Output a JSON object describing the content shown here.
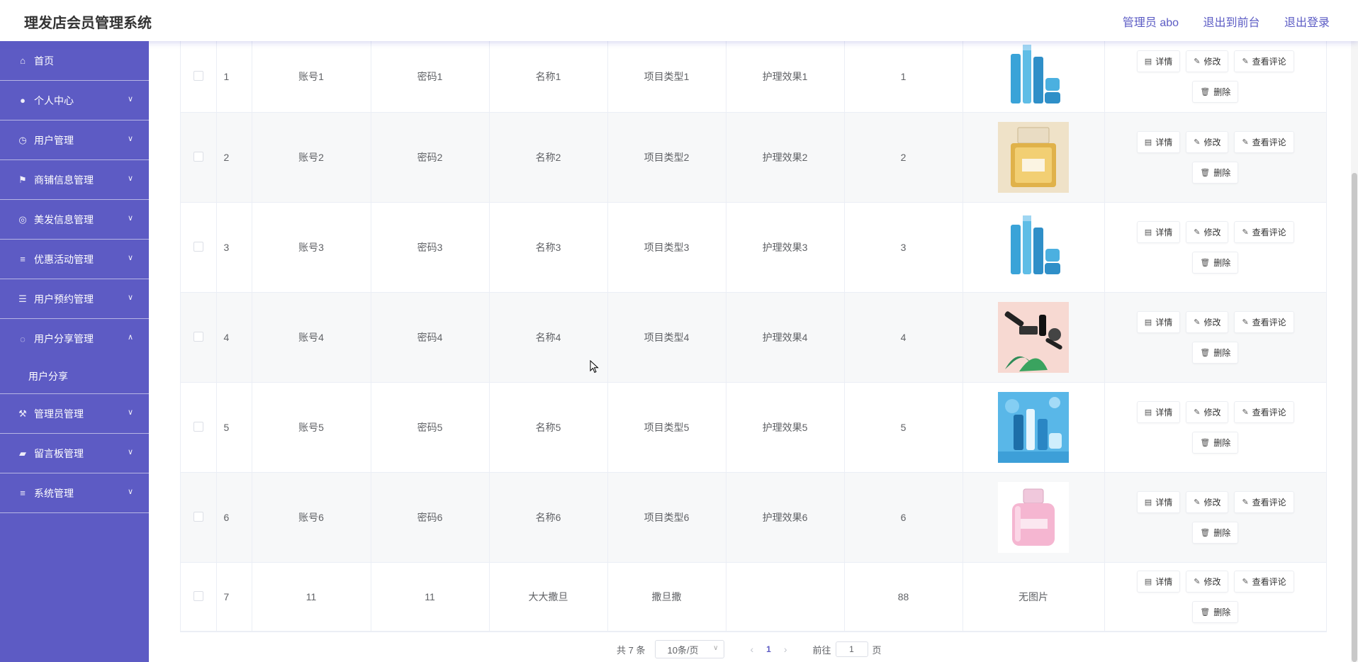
{
  "header": {
    "title": "理发店会员管理系统",
    "admin_label": "管理员 abo",
    "to_front": "退出到前台",
    "logout": "退出登录"
  },
  "sidebar": {
    "items": [
      {
        "label": "首页",
        "icon": "home-icon",
        "chevron": false
      },
      {
        "label": "个人中心",
        "icon": "user-icon",
        "chevron": true
      },
      {
        "label": "用户管理",
        "icon": "clock-icon",
        "chevron": true
      },
      {
        "label": "商铺信息管理",
        "icon": "flag-icon",
        "chevron": true
      },
      {
        "label": "美发信息管理",
        "icon": "compass-icon",
        "chevron": true
      },
      {
        "label": "优惠活动管理",
        "icon": "list-icon",
        "chevron": true
      },
      {
        "label": "用户预约管理",
        "icon": "sliders-icon",
        "chevron": true
      },
      {
        "label": "用户分享管理",
        "icon": "target-icon",
        "chevron": true,
        "expanded": true,
        "sub": "用户分享"
      },
      {
        "label": "管理员管理",
        "icon": "tools-icon",
        "chevron": true
      },
      {
        "label": "留言板管理",
        "icon": "ticket-icon",
        "chevron": true
      },
      {
        "label": "系统管理",
        "icon": "menu-icon",
        "chevron": true
      }
    ]
  },
  "table": {
    "rows": [
      {
        "no": "1",
        "account": "账号1",
        "password": "密码1",
        "name": "名称1",
        "type": "项目类型1",
        "effect": "护理效果1",
        "count": "1",
        "image": "skincare-blue"
      },
      {
        "no": "2",
        "account": "账号2",
        "password": "密码2",
        "name": "名称2",
        "type": "项目类型2",
        "effect": "护理效果2",
        "count": "2",
        "image": "perfume-gold"
      },
      {
        "no": "3",
        "account": "账号3",
        "password": "密码3",
        "name": "名称3",
        "type": "项目类型3",
        "effect": "护理效果3",
        "count": "3",
        "image": "skincare-blue"
      },
      {
        "no": "4",
        "account": "账号4",
        "password": "密码4",
        "name": "名称4",
        "type": "项目类型4",
        "effect": "护理效果4",
        "count": "4",
        "image": "makeup-pink"
      },
      {
        "no": "5",
        "account": "账号5",
        "password": "密码5",
        "name": "名称5",
        "type": "项目类型5",
        "effect": "护理效果5",
        "count": "5",
        "image": "skincare-splash"
      },
      {
        "no": "6",
        "account": "账号6",
        "password": "密码6",
        "name": "名称6",
        "type": "项目类型6",
        "effect": "护理效果6",
        "count": "6",
        "image": "perfume-pink"
      },
      {
        "no": "7",
        "account": "11",
        "password": "11",
        "name": "大大撒旦",
        "type": "撒旦撒",
        "effect": "",
        "count": "88",
        "image": "none",
        "no_image_text": "无图片"
      }
    ],
    "buttons": {
      "detail": "详情",
      "edit": "修改",
      "comments": "查看评论",
      "delete": "删除"
    }
  },
  "pagination": {
    "total": "共 7 条",
    "page_size": "10条/页",
    "current": "1",
    "goto_prefix": "前往",
    "goto_value": "1",
    "goto_suffix": "页"
  },
  "colors": {
    "accent": "#5d5bc4"
  }
}
